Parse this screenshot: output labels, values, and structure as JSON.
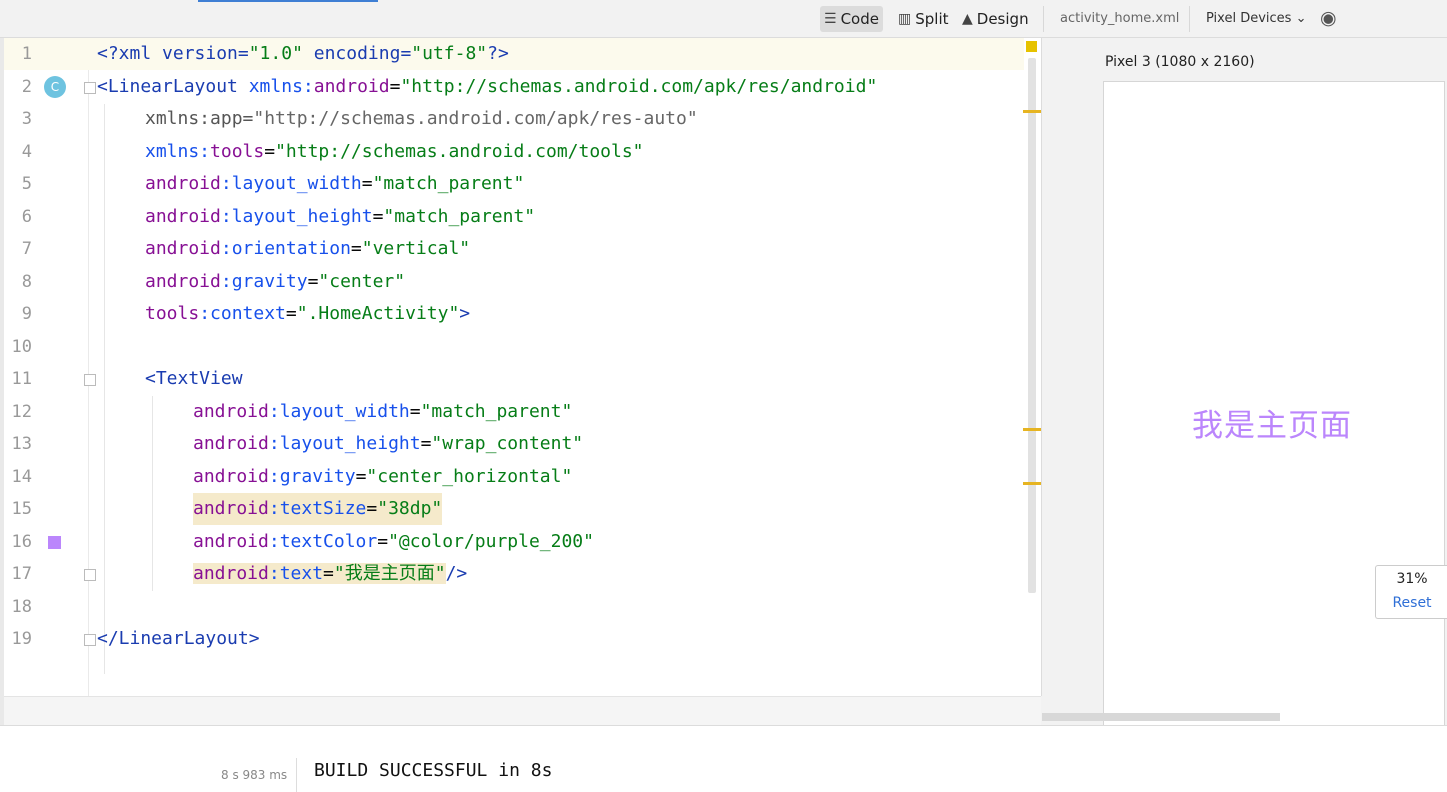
{
  "toolbar": {
    "modes": [
      {
        "label": "Code",
        "icon": "list-icon",
        "active": true
      },
      {
        "label": "Split",
        "icon": "split-icon",
        "active": false
      },
      {
        "label": "Design",
        "icon": "image-icon",
        "active": false
      }
    ],
    "file_name": "activity_home.xml",
    "device_dropdown": "Pixel Devices",
    "dropdown_glyph": "⌄",
    "eye_glyph": "◉"
  },
  "editor": {
    "line_numbers": [
      "1",
      "2",
      "3",
      "4",
      "5",
      "6",
      "7",
      "8",
      "9",
      "10",
      "11",
      "12",
      "13",
      "14",
      "15",
      "16",
      "17",
      "18",
      "19"
    ],
    "gutter_badge": "C",
    "swatch_color": "#bb86fc",
    "lines": {
      "l1": {
        "a": "<?xml version=",
        "b": "\"1.0\"",
        "c": " encoding=",
        "d": "\"utf-8\"",
        "e": "?>"
      },
      "l2": {
        "a": "<LinearLayout ",
        "b": "xmlns:",
        "c": "android",
        "d": "=",
        "e": "\"http://schemas.android.com/apk/res/android\""
      },
      "l3": {
        "a": "xmlns:app=",
        "b": "\"http://schemas.android.com/apk/res-auto\""
      },
      "l4": {
        "a": "xmlns:",
        "b": "tools",
        "c": "=",
        "d": "\"http://schemas.android.com/tools\""
      },
      "l5": {
        "a": "android",
        "b": ":layout_width",
        "c": "=",
        "d": "\"match_parent\""
      },
      "l6": {
        "a": "android",
        "b": ":layout_height",
        "c": "=",
        "d": "\"match_parent\""
      },
      "l7": {
        "a": "android",
        "b": ":orientation",
        "c": "=",
        "d": "\"vertical\""
      },
      "l8": {
        "a": "android",
        "b": ":gravity",
        "c": "=",
        "d": "\"center\""
      },
      "l9": {
        "a": "tools",
        "b": ":context",
        "c": "=",
        "d": "\".HomeActivity\"",
        "e": ">"
      },
      "l11": {
        "a": "<TextView"
      },
      "l12": {
        "a": "android",
        "b": ":layout_width",
        "c": "=",
        "d": "\"match_parent\""
      },
      "l13": {
        "a": "android",
        "b": ":layout_height",
        "c": "=",
        "d": "\"wrap_content\""
      },
      "l14": {
        "a": "android",
        "b": ":gravity",
        "c": "=",
        "d": "\"center_horizontal\""
      },
      "l15": {
        "a": "android",
        "b": ":textSize",
        "c": "=",
        "d": "\"38dp\""
      },
      "l16": {
        "a": "android",
        "b": ":textColor",
        "c": "=",
        "d": "\"@color/purple_200\""
      },
      "l17": {
        "a": "android",
        "b": ":text",
        "c": "=",
        "d": "\"我是主页面\"",
        "e": "/>"
      },
      "l19": {
        "a": "</LinearLayout>"
      }
    }
  },
  "preview": {
    "device_label": "Pixel 3 (1080 x 2160)",
    "rendered_text": "我是主页面",
    "text_color": "#bb86fc",
    "zoom": "31%",
    "reset_label": "Reset"
  },
  "build": {
    "time": "8 s 983 ms",
    "message": "BUILD SUCCESSFUL in 8s"
  }
}
